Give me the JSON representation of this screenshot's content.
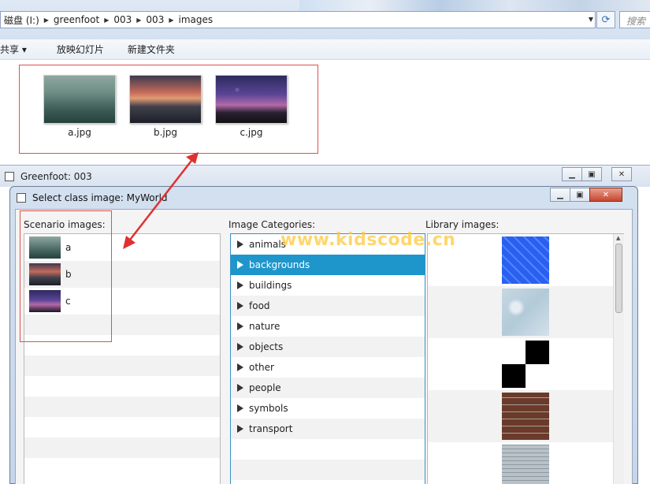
{
  "explorer": {
    "crumbs": [
      "磁盘 (I:)",
      "greenfoot",
      "003",
      "003",
      "images"
    ],
    "search_placeholder": "搜索",
    "toolbar": [
      "共享 ▾",
      "放映幻灯片",
      "新建文件夹"
    ],
    "files": [
      {
        "name": "a.jpg",
        "icon": "photo-mist-lake"
      },
      {
        "name": "b.jpg",
        "icon": "photo-sunset-river"
      },
      {
        "name": "c.jpg",
        "icon": "photo-star-trails"
      }
    ]
  },
  "greenfoot_window": {
    "title": "Greenfoot: 003"
  },
  "dialog": {
    "title": "Select class image: MyWorld",
    "scenario_label": "Scenario images:",
    "categories_label": "Image Categories:",
    "library_label": "Library images:",
    "scenario_images": [
      "a",
      "b",
      "c"
    ],
    "categories": [
      "animals",
      "backgrounds",
      "buildings",
      "food",
      "nature",
      "objects",
      "other",
      "people",
      "symbols",
      "transport"
    ],
    "selected_category": "backgrounds",
    "library_images": [
      "blue-tiles",
      "snow",
      "checker",
      "brick",
      "stone"
    ]
  },
  "watermark": "www.kidscode.cn",
  "colors": {
    "selection": "#1e96cc",
    "highlight": "#e05050",
    "arrow": "#e03030"
  }
}
